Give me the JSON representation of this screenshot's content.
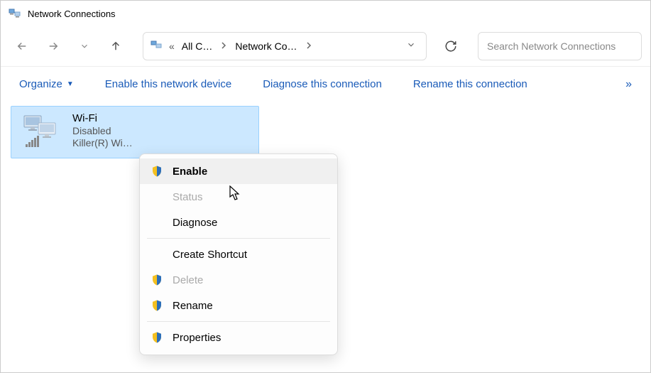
{
  "window": {
    "title": "Network Connections"
  },
  "breadcrumb": {
    "prefix": "«",
    "items": [
      "All C…",
      "Network Co…"
    ]
  },
  "search": {
    "placeholder": "Search Network Connections"
  },
  "toolbar": {
    "organize": "Organize",
    "enable_device": "Enable this network device",
    "diagnose": "Diagnose this connection",
    "rename": "Rename this connection",
    "overflow": "»"
  },
  "connection": {
    "name": "Wi-Fi",
    "status": "Disabled",
    "adapter": "Killer(R) Wi…"
  },
  "context_menu": {
    "enable": "Enable",
    "status": "Status",
    "diagnose": "Diagnose",
    "create_shortcut": "Create Shortcut",
    "delete": "Delete",
    "rename": "Rename",
    "properties": "Properties"
  }
}
